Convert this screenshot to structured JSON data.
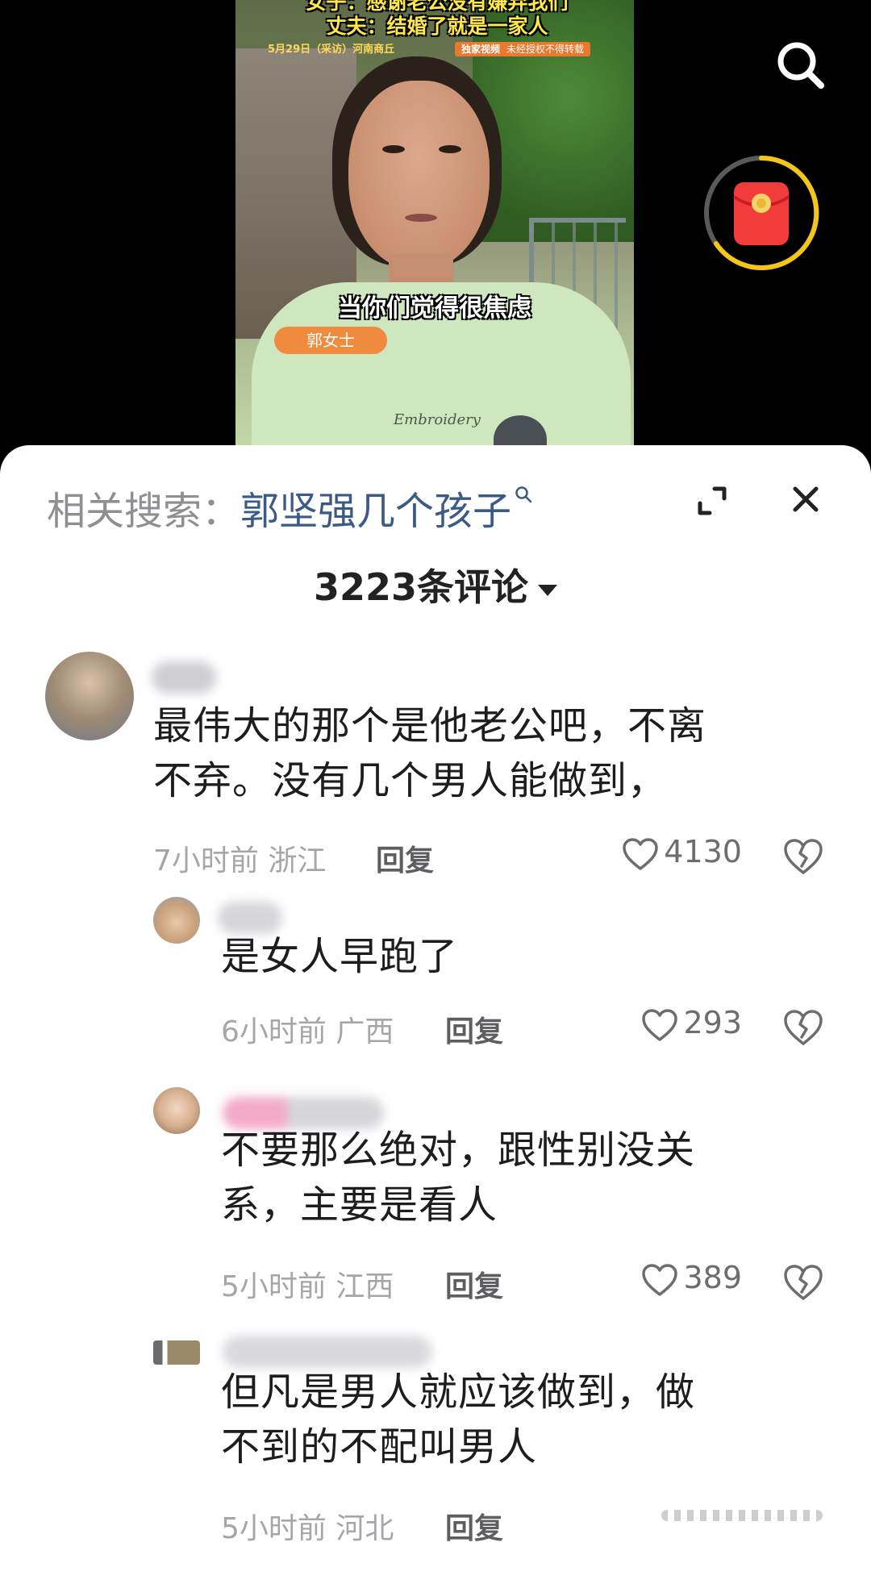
{
  "video": {
    "headline_line1": "女子：感谢老公没有嫌弃我们",
    "headline_line2": "丈夫：结婚了就是一家人",
    "meta": "5月29日（采访）河南商丘",
    "badge_left": "独家视频",
    "badge_right": "未经授权不得转载",
    "subtitle": "当你们觉得很焦虑",
    "name_tag": "郭女士",
    "shirt_text": "Embroidery"
  },
  "overlay": {
    "search_icon": "search-icon",
    "red_packet_icon": "red-packet-icon"
  },
  "sheet": {
    "related_label": "相关搜索：",
    "related_query": "郭坚强几个孩子",
    "comment_count": "3223条评论"
  },
  "comments": [
    {
      "text_line1": "最伟大的那个是他老公吧，不离",
      "text_line2": "不弃。没有几个男人能做到，",
      "time": "7小时前",
      "location": "浙江",
      "reply": "回复",
      "likes": "4130"
    },
    {
      "text_line1": "是女人早跑了",
      "time": "6小时前",
      "location": "广西",
      "reply": "回复",
      "likes": "293"
    },
    {
      "text_line1": "不要那么绝对，跟性别没关",
      "text_line2": "系，主要是看人",
      "time": "5小时前",
      "location": "江西",
      "reply": "回复",
      "likes": "389"
    },
    {
      "text_line1": "但凡是男人就应该做到，做",
      "text_line2": "不到的不配叫男人",
      "time": "5小时前",
      "location": "河北",
      "reply": "回复"
    }
  ],
  "colors": {
    "accent_link": "#3b5a86",
    "red_packet": "#f23b3b",
    "ring": "#f5c518"
  }
}
